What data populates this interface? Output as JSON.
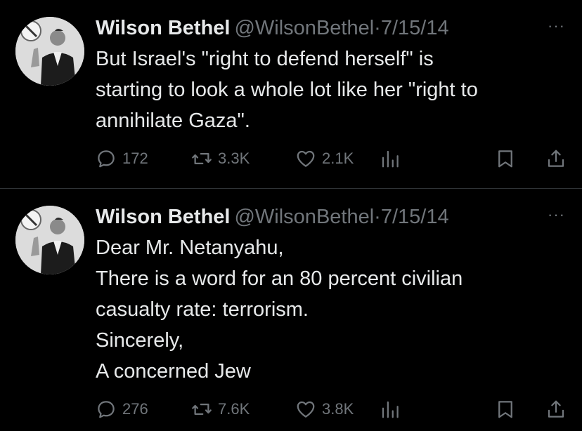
{
  "tweets": [
    {
      "name": "Wilson Bethel",
      "handle": "@WilsonBethel",
      "separator": "·",
      "date": "7/15/14",
      "more": "···",
      "lines": [
        "But Israel's \"right to defend herself\" is",
        "starting to look a whole lot like her \"right to",
        "annihilate Gaza\"."
      ],
      "replies": "172",
      "retweets": "3.3K",
      "likes": "2.1K"
    },
    {
      "name": "Wilson Bethel",
      "handle": "@WilsonBethel",
      "separator": "·",
      "date": "7/15/14",
      "more": "···",
      "lines": [
        "Dear Mr. Netanyahu,",
        "There is a word for an 80 percent civilian",
        "casualty rate: terrorism.",
        "Sincerely,",
        "A concerned Jew"
      ],
      "replies": "276",
      "retweets": "7.6K",
      "likes": "3.8K"
    }
  ],
  "icons": {
    "reply": "reply-icon",
    "retweet": "retweet-icon",
    "like": "heart-icon",
    "views": "views-icon",
    "bookmark": "bookmark-icon",
    "share": "share-icon"
  },
  "colors": {
    "background": "#000000",
    "text": "#e7e9ea",
    "secondary": "#71767b",
    "divider": "#2f3336"
  }
}
